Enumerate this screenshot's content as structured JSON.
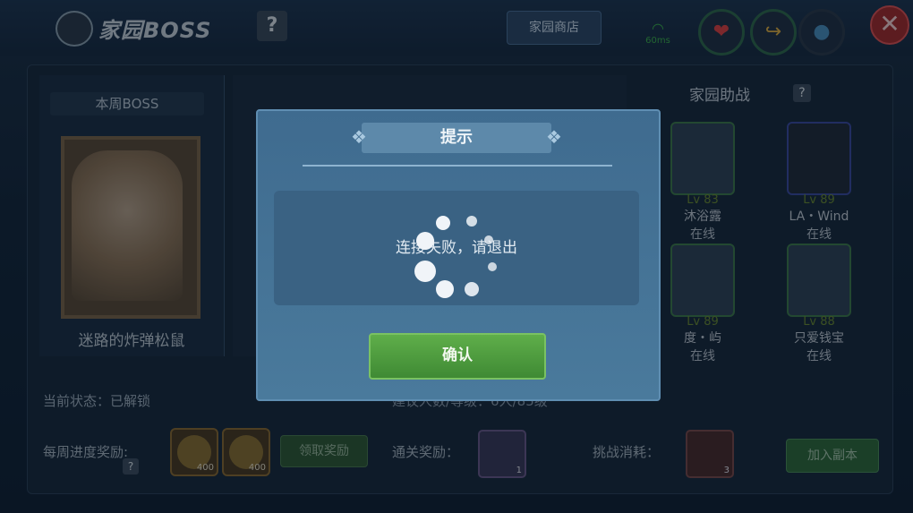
{
  "header": {
    "title": "家园BOSS",
    "help_label": "?",
    "shop_label": "家园商店",
    "wifi_label": "60ms",
    "close_label": "✕"
  },
  "resources": [
    {
      "icon": "heart-icon",
      "glyph": "❤",
      "color": "#e04040"
    },
    {
      "icon": "arrow-icon",
      "glyph": "↪",
      "color": "#e0b040"
    },
    {
      "icon": "drop-icon",
      "glyph": "💧",
      "color": "#4a90c0"
    }
  ],
  "boss": {
    "section_label": "本周BOSS",
    "name": "迷路的炸弹松鼠"
  },
  "assist": {
    "title": "家园助战",
    "help_label": "?",
    "friends": [
      {
        "level": "Lv 83",
        "name": "沐浴露",
        "status": "在线"
      },
      {
        "level": "Lv 89",
        "name": "LA・Wind",
        "status": "在线"
      },
      {
        "level": "Lv 89",
        "name": "度・屿",
        "status": "在线"
      },
      {
        "level": "Lv 88",
        "name": "只爱钱宝",
        "status": "在线"
      }
    ]
  },
  "bottom": {
    "status_text": "当前状态：已解锁",
    "recommend_text": "建议人数/等级：6人/85级",
    "weekly_label": "每周进度奖励:",
    "weekly_help": "?",
    "coin1_count": "400",
    "coin2_count": "400",
    "claim_label": "领取奖励",
    "clear_label": "通关奖励：",
    "clear_item_count": "1",
    "cost_label": "挑战消耗：",
    "cost_item_count": "3",
    "join_label": "加入副本"
  },
  "dialog": {
    "title": "提示",
    "message": "连接失败，请退出",
    "confirm_label": "确认"
  }
}
